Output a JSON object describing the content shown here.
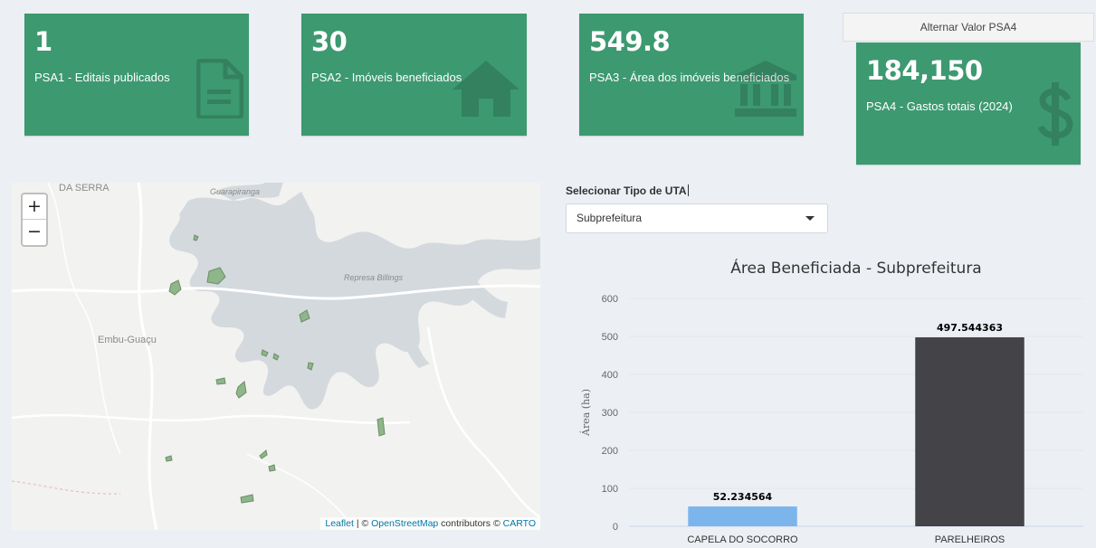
{
  "kpis": [
    {
      "value": "1",
      "label": "PSA1 - Editais publicados",
      "icon": "file-text-icon"
    },
    {
      "value": "30",
      "label": "PSA2 - Imóveis beneficiados",
      "icon": "home-icon"
    },
    {
      "value": "549.8",
      "label": "PSA3 - Área dos imóveis beneficiados",
      "icon": "institution-icon"
    },
    {
      "value": "184,150",
      "label": "PSA4 - Gastos totais (2024)",
      "icon": "dollar-icon"
    }
  ],
  "toggle_button": "Alternar Valor PSA4",
  "map": {
    "zoom_in": "+",
    "zoom_out": "−",
    "place_labels": [
      "DA SERRA",
      "Guarapiranga",
      "Represa Billings",
      "Embu-Guaçu"
    ],
    "attribution": {
      "leaflet": "Leaflet",
      "sep": " | © ",
      "osm": "OpenStreetMap",
      "mid": " contributors © ",
      "carto": "CARTO"
    }
  },
  "uta_select": {
    "label": "Selecionar Tipo de UTA",
    "value": "Subprefeitura"
  },
  "colors": {
    "box_green": "#3d9970",
    "bar_blue": "#7cb5ec",
    "bar_dark": "#434348"
  },
  "chart_data": {
    "type": "bar",
    "title": "Área Beneficiada - Subprefeitura",
    "ylabel": "Área (ha)",
    "xlabel": "",
    "categories": [
      "CAPELA DO SOCORRO",
      "PARELHEIROS"
    ],
    "values": [
      52.234564,
      497.544363
    ],
    "data_labels": [
      "52.234564",
      "497.544363"
    ],
    "bar_colors": [
      "#7cb5ec",
      "#434348"
    ],
    "ylim": [
      0,
      600
    ],
    "yticks": [
      0,
      100,
      200,
      300,
      400,
      500,
      600
    ],
    "grid": true,
    "legend": "none"
  }
}
